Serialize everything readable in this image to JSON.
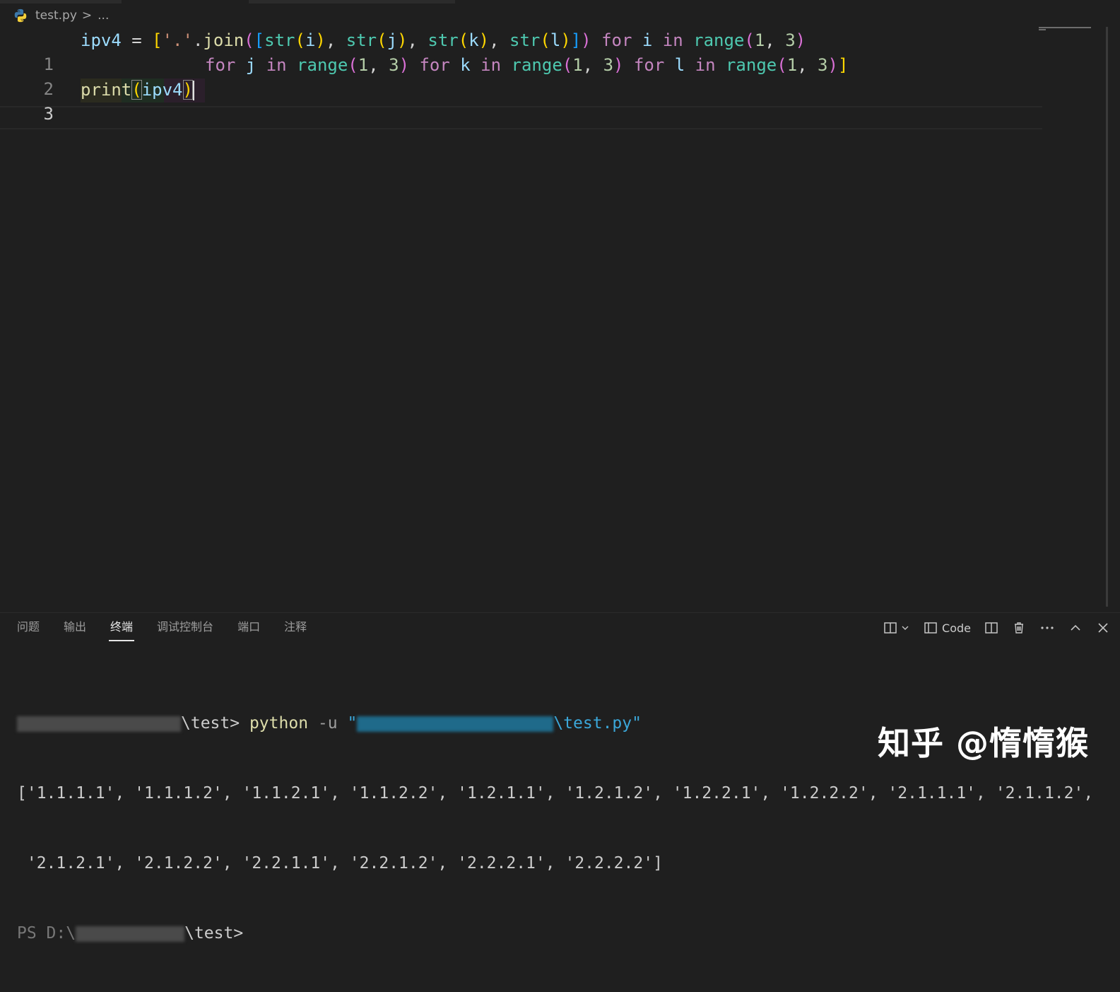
{
  "breadcrumb": {
    "file": "test.py",
    "separator": ">",
    "ellipsis": "..."
  },
  "editor": {
    "line_numbers": [
      "1",
      "2",
      "3"
    ],
    "line1": [
      {
        "t": "ipv4",
        "c": "v"
      },
      {
        "t": " = ",
        "c": "op"
      },
      {
        "t": "[",
        "c": "p1"
      },
      {
        "t": "'.'",
        "c": "s"
      },
      {
        "t": ".",
        "c": "op"
      },
      {
        "t": "join",
        "c": "f"
      },
      {
        "t": "(",
        "c": "p2"
      },
      {
        "t": "[",
        "c": "p3"
      },
      {
        "t": "str",
        "c": "b"
      },
      {
        "t": "(",
        "c": "p1"
      },
      {
        "t": "i",
        "c": "v"
      },
      {
        "t": ")",
        "c": "p1"
      },
      {
        "t": ", ",
        "c": "op"
      },
      {
        "t": "str",
        "c": "b"
      },
      {
        "t": "(",
        "c": "p1"
      },
      {
        "t": "j",
        "c": "v"
      },
      {
        "t": ")",
        "c": "p1"
      },
      {
        "t": ", ",
        "c": "op"
      },
      {
        "t": "str",
        "c": "b"
      },
      {
        "t": "(",
        "c": "p1"
      },
      {
        "t": "k",
        "c": "v"
      },
      {
        "t": ")",
        "c": "p1"
      },
      {
        "t": ", ",
        "c": "op"
      },
      {
        "t": "str",
        "c": "b"
      },
      {
        "t": "(",
        "c": "p1"
      },
      {
        "t": "l",
        "c": "v"
      },
      {
        "t": ")",
        "c": "p1"
      },
      {
        "t": "]",
        "c": "p3"
      },
      {
        "t": ")",
        "c": "p2"
      },
      {
        "t": " for ",
        "c": "k"
      },
      {
        "t": "i",
        "c": "v"
      },
      {
        "t": " in ",
        "c": "k"
      },
      {
        "t": "range",
        "c": "b"
      },
      {
        "t": "(",
        "c": "p2"
      },
      {
        "t": "1",
        "c": "n"
      },
      {
        "t": ", ",
        "c": "op"
      },
      {
        "t": "3",
        "c": "n"
      },
      {
        "t": ")",
        "c": "p2"
      }
    ],
    "line2": [
      {
        "t": "for ",
        "c": "k"
      },
      {
        "t": "j",
        "c": "v"
      },
      {
        "t": " in ",
        "c": "k"
      },
      {
        "t": "range",
        "c": "b"
      },
      {
        "t": "(",
        "c": "p2"
      },
      {
        "t": "1",
        "c": "n"
      },
      {
        "t": ", ",
        "c": "op"
      },
      {
        "t": "3",
        "c": "n"
      },
      {
        "t": ")",
        "c": "p2"
      },
      {
        "t": " for ",
        "c": "k"
      },
      {
        "t": "k",
        "c": "v"
      },
      {
        "t": " in ",
        "c": "k"
      },
      {
        "t": "range",
        "c": "b"
      },
      {
        "t": "(",
        "c": "p2"
      },
      {
        "t": "1",
        "c": "n"
      },
      {
        "t": ", ",
        "c": "op"
      },
      {
        "t": "3",
        "c": "n"
      },
      {
        "t": ")",
        "c": "p2"
      },
      {
        "t": " for ",
        "c": "k"
      },
      {
        "t": "l",
        "c": "v"
      },
      {
        "t": " in ",
        "c": "k"
      },
      {
        "t": "range",
        "c": "b"
      },
      {
        "t": "(",
        "c": "p2"
      },
      {
        "t": "1",
        "c": "n"
      },
      {
        "t": ", ",
        "c": "op"
      },
      {
        "t": "3",
        "c": "n"
      },
      {
        "t": ")",
        "c": "p2"
      },
      {
        "t": "]",
        "c": "p1"
      }
    ],
    "line3": [
      {
        "t": "print",
        "c": "f"
      },
      {
        "t": "(",
        "c": "p1",
        "box": true
      },
      {
        "t": "ipv4",
        "c": "v"
      },
      {
        "t": ")",
        "c": "p1",
        "box": true
      }
    ]
  },
  "panel": {
    "tabs": [
      "问题",
      "输出",
      "终端",
      "调试控制台",
      "端口",
      "注释"
    ],
    "active_tab": "终端",
    "actions": {
      "code_label": "Code"
    }
  },
  "terminal": {
    "prompt_suffix": "\\test>",
    "command": "python",
    "flag": "-u",
    "path_open": "\"",
    "path_end": "\\test.py\"",
    "output_line1": "['1.1.1.1', '1.1.1.2', '1.1.2.1', '1.1.2.2', '1.2.1.1', '1.2.1.2', '1.2.2.1', '1.2.2.2', '2.1.1.1', '2.1.1.2',",
    "output_line2": " '2.1.2.1', '2.1.2.2', '2.2.1.1', '2.2.1.2', '2.2.2.1', '2.2.2.2']",
    "prompt2_prefix": "PS D:\\",
    "prompt2_suffix": "\\test>"
  },
  "watermark": "知乎 @惰惰猴"
}
